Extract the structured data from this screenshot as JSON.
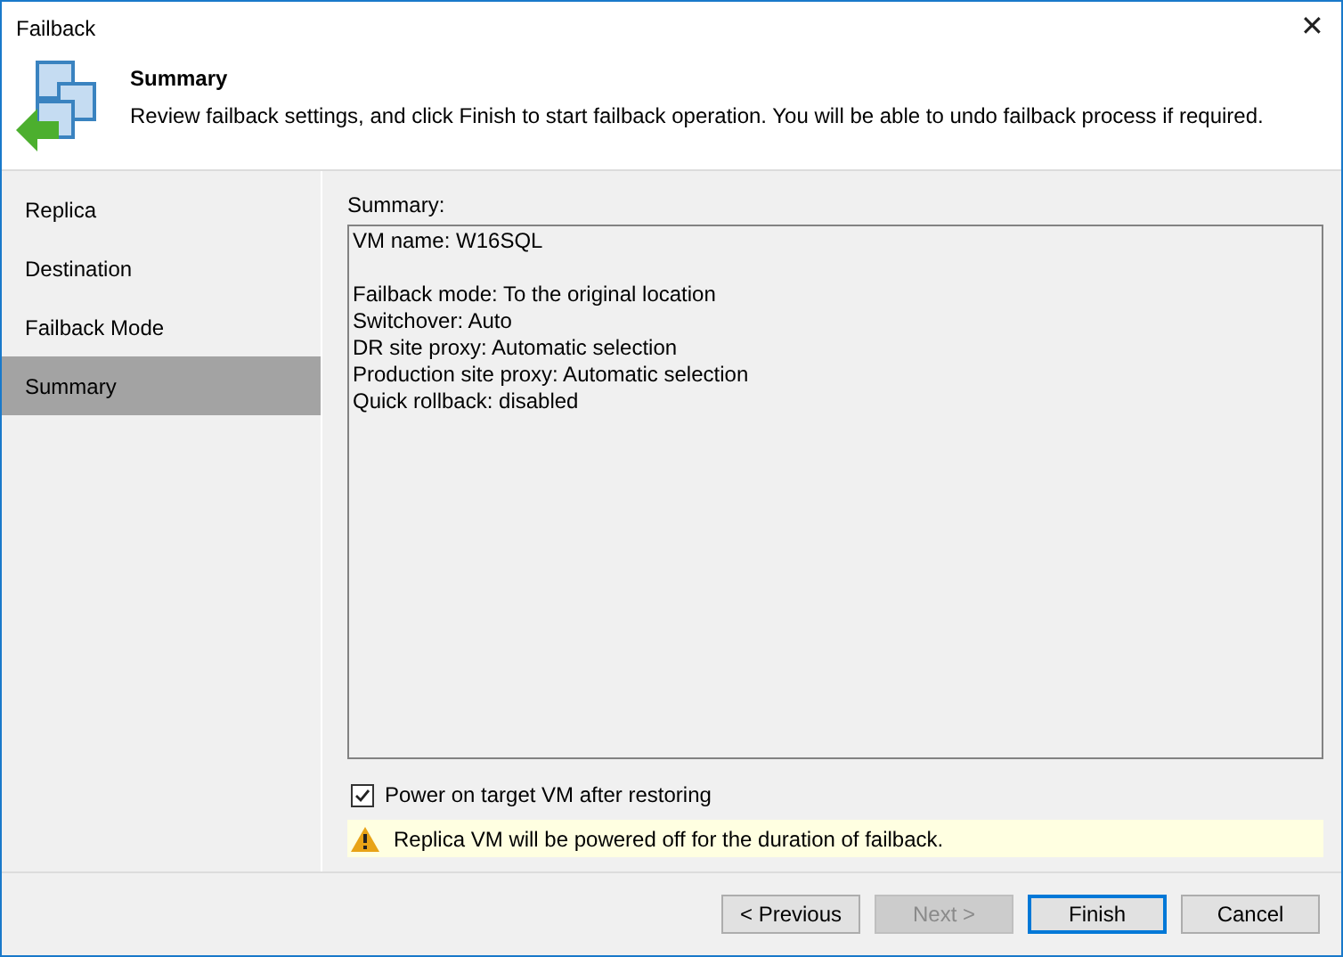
{
  "window": {
    "title": "Failback",
    "close": "✕"
  },
  "header": {
    "title": "Summary",
    "description": "Review failback settings, and click Finish to start failback operation. You will be able to undo failback process if required."
  },
  "steps": [
    {
      "label": "Replica",
      "selected": false
    },
    {
      "label": "Destination",
      "selected": false
    },
    {
      "label": "Failback Mode",
      "selected": false
    },
    {
      "label": "Summary",
      "selected": true
    }
  ],
  "summary": {
    "label": "Summary:",
    "groups": [
      [
        "VM name: W16SQL"
      ],
      [
        "Failback mode: To the original location",
        "Switchover: Auto",
        "DR site proxy: Automatic selection",
        "Production site proxy: Automatic selection",
        "Quick rollback: disabled"
      ]
    ]
  },
  "power_on": {
    "label": "Power on target VM after restoring",
    "checked": true
  },
  "warning": {
    "text": "Replica VM will be powered off for the duration of failback."
  },
  "buttons": [
    {
      "label": "< Previous",
      "disabled": false,
      "default": false
    },
    {
      "label": "Next >",
      "disabled": true,
      "default": false
    },
    {
      "label": "Finish",
      "disabled": false,
      "default": true
    },
    {
      "label": "Cancel",
      "disabled": false,
      "default": false
    }
  ]
}
